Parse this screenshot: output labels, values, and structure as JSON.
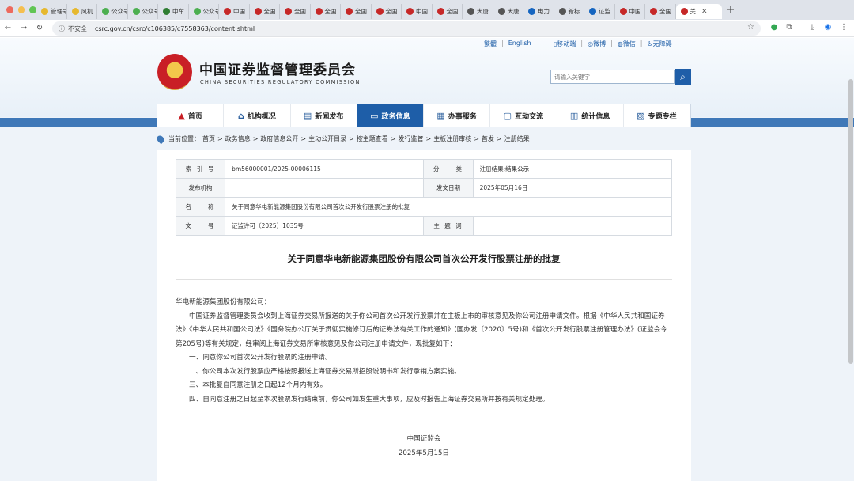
{
  "browser": {
    "tabs": [
      {
        "label": "管理号",
        "color": "#e6b82e"
      },
      {
        "label": "风机",
        "color": "#e6b82e"
      },
      {
        "label": "公众号",
        "color": "#4caf50"
      },
      {
        "label": "公众号",
        "color": "#4caf50"
      },
      {
        "label": "中车",
        "color": "#2e7d32"
      },
      {
        "label": "公众号",
        "color": "#4caf50"
      },
      {
        "label": "中国",
        "color": "#c62828"
      },
      {
        "label": "全国",
        "color": "#c62828"
      },
      {
        "label": "全国",
        "color": "#c62828"
      },
      {
        "label": "全国",
        "color": "#c62828"
      },
      {
        "label": "全国",
        "color": "#c62828"
      },
      {
        "label": "全国",
        "color": "#c62828"
      },
      {
        "label": "中国",
        "color": "#c62828"
      },
      {
        "label": "全国",
        "color": "#c62828"
      },
      {
        "label": "大唐",
        "color": "#555555"
      },
      {
        "label": "大唐",
        "color": "#555555"
      },
      {
        "label": "电力",
        "color": "#1565c0"
      },
      {
        "label": "新标",
        "color": "#555555"
      },
      {
        "label": "证监",
        "color": "#1565c0"
      },
      {
        "label": "中国",
        "color": "#c62828"
      },
      {
        "label": "全国",
        "color": "#c62828"
      }
    ],
    "active_tab": {
      "label": "关",
      "color": "#c62828"
    },
    "close_glyph": "✕",
    "newtab_glyph": "+",
    "insecure_label": "不安全",
    "url": "csrc.gov.cn/csrc/c106385/c7558363/content.shtml"
  },
  "header": {
    "top_links": [
      "繁體",
      "English"
    ],
    "top_right_links": [
      "移动端",
      "微博",
      "微信",
      "无障碍"
    ],
    "site_name_cn": "中国证券监督管理委员会",
    "site_name_en": "CHINA SECURITIES REGULATORY COMMISSION",
    "search_placeholder": "请输入关键字"
  },
  "nav": {
    "items": [
      {
        "label": "首页",
        "icon": "home-icon"
      },
      {
        "label": "机构概况",
        "icon": "building-icon"
      },
      {
        "label": "新闻发布",
        "icon": "news-icon"
      },
      {
        "label": "政务信息",
        "icon": "monitor-icon"
      },
      {
        "label": "办事服务",
        "icon": "document-icon"
      },
      {
        "label": "互动交流",
        "icon": "chat-icon"
      },
      {
        "label": "统计信息",
        "icon": "chart-icon"
      },
      {
        "label": "专题专栏",
        "icon": "folder-icon"
      }
    ],
    "active_index": 3
  },
  "breadcrumb": {
    "prefix": "当前位置：",
    "items": [
      "首页",
      "政务信息",
      "政府信息公开",
      "主动公开目录",
      "按主题查看",
      "发行监管",
      "主板注册审核",
      "首发",
      "注册结果"
    ]
  },
  "meta": {
    "index_label": "索 引 号",
    "index_value": "bm56000001/2025-00006115",
    "category_label": "分　　类",
    "category_value": "注册结果;结果公示",
    "issuer_label": "发布机构",
    "issuer_value": "",
    "date_label": "发文日期",
    "date_value": "2025年05月16日",
    "name_label": "名　　称",
    "name_value": "关于同意华电新能源集团股份有限公司首次公开发行股票注册的批复",
    "docno_label": "文　　号",
    "docno_value": "证监许可〔2025〕1035号",
    "subject_label": "主 题 词",
    "subject_value": ""
  },
  "document": {
    "title": "关于同意华电新能源集团股份有限公司首次公开发行股票注册的批复",
    "salutation": "华电新能源集团股份有限公司：",
    "paragraphs": [
      "中国证券监督管理委员会收到上海证券交易所报送的关于你公司首次公开发行股票并在主板上市的审核意见及你公司注册申请文件。根据《中华人民共和国证券法》《中华人民共和国公司法》《国务院办公厅关于贯彻实施修订后的证券法有关工作的通知》(国办发〔2020〕5号)和《首次公开发行股票注册管理办法》(证监会令第205号)等有关规定，经审阅上海证券交易所审核意见及你公司注册申请文件，现批复如下：",
      "一、同意你公司首次公开发行股票的注册申请。",
      "二、你公司本次发行股票应严格按照报送上海证券交易所招股说明书和发行承销方案实施。",
      "三、本批复自同意注册之日起12个月内有效。",
      "四、自同意注册之日起至本次股票发行结束前，你公司如发生重大事项，应及时报告上海证券交易所并按有关规定处理。"
    ],
    "signer": "中国证监会",
    "sign_date": "2025年5月15日"
  }
}
